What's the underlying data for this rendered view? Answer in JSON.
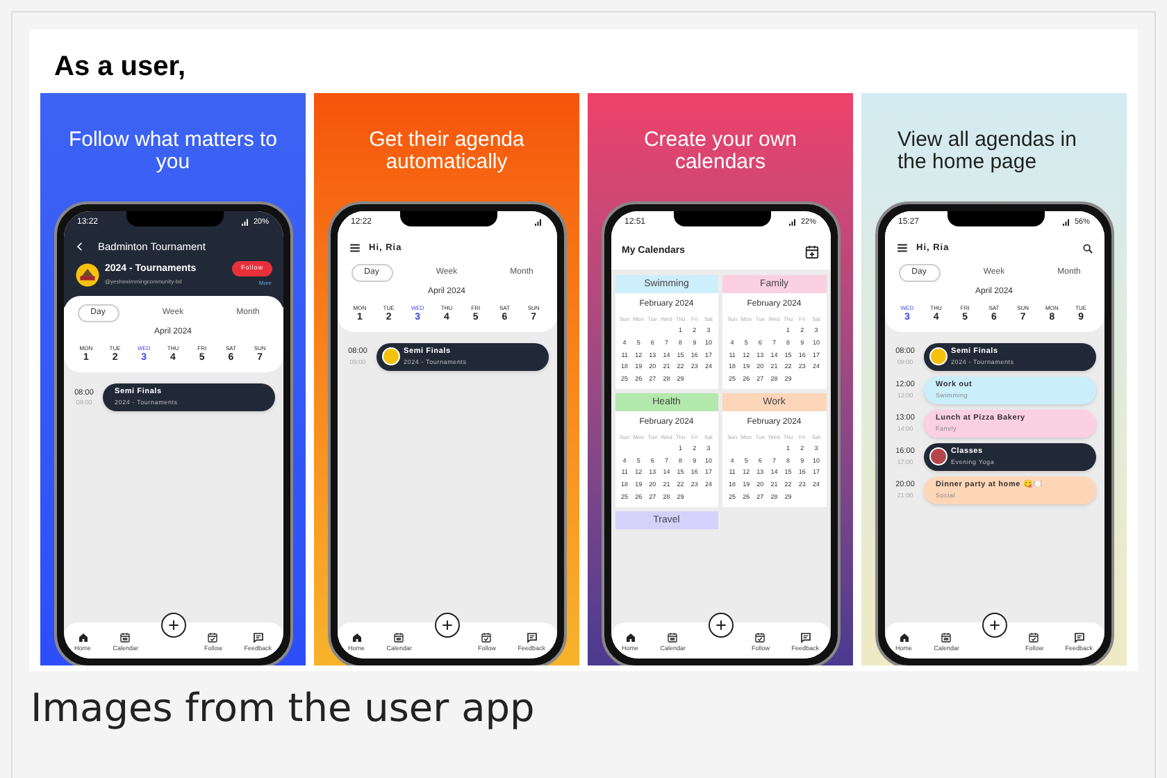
{
  "heading": "As a user,",
  "panels": [
    {
      "kind": "follow",
      "headline": "Follow what matters to you",
      "time": "13:22",
      "battery": "20%",
      "title": "Badminton Tournament",
      "org": "2024 - Tournaments",
      "handle": "@yeshswimmingcommunity-bd",
      "follow_button": "Follow",
      "more_link": "More",
      "view_tabs": [
        {
          "label": "Day",
          "selected": true
        },
        {
          "label": "Week",
          "selected": false
        },
        {
          "label": "Month",
          "selected": false
        }
      ],
      "month": "April 2024",
      "days": [
        {
          "dow": "MON",
          "date": "1",
          "selected": false
        },
        {
          "dow": "TUE",
          "date": "2",
          "selected": false
        },
        {
          "dow": "WED",
          "date": "3",
          "selected": true
        },
        {
          "dow": "THU",
          "date": "4",
          "selected": false
        },
        {
          "dow": "FRI",
          "date": "5",
          "selected": false
        },
        {
          "dow": "SAT",
          "date": "6",
          "selected": false
        },
        {
          "dow": "SUN",
          "date": "7",
          "selected": false
        }
      ],
      "events": [
        {
          "start": "08:00",
          "end": "09:00",
          "title": "Semi Finals",
          "subtitle": "2024 - Tournaments",
          "color": "#222936",
          "kind": "plain"
        }
      ],
      "nav": [
        {
          "label": "Home",
          "kind": "home"
        },
        {
          "label": "Calendar",
          "kind": "calendar"
        },
        {
          "label": "Follow",
          "kind": "follow"
        },
        {
          "label": "Feedback",
          "kind": "feedback"
        }
      ]
    },
    {
      "kind": "home",
      "headline": "Get their agenda automatically",
      "time": "12:22",
      "greeting": "Hi, Ria",
      "search_icon": false,
      "view_tabs": [
        {
          "label": "Day",
          "selected": true
        },
        {
          "label": "Week",
          "selected": false
        },
        {
          "label": "Month",
          "selected": false
        }
      ],
      "month": "April 2024",
      "days": [
        {
          "dow": "MON",
          "date": "1",
          "selected": false
        },
        {
          "dow": "TUE",
          "date": "2",
          "selected": false
        },
        {
          "dow": "WED",
          "date": "3",
          "selected": true
        },
        {
          "dow": "THU",
          "date": "4",
          "selected": false
        },
        {
          "dow": "FRI",
          "date": "5",
          "selected": false
        },
        {
          "dow": "SAT",
          "date": "6",
          "selected": false
        },
        {
          "dow": "SUN",
          "date": "7",
          "selected": false
        }
      ],
      "events": [
        {
          "start": "08:00",
          "end": "09:00",
          "title": "Semi Finals",
          "subtitle": "2024 - Tournaments",
          "color": "#222936",
          "kind": "team"
        }
      ],
      "nav": [
        {
          "label": "Home",
          "kind": "home"
        },
        {
          "label": "Calendar",
          "kind": "calendar"
        },
        {
          "label": "Follow",
          "kind": "follow"
        },
        {
          "label": "Feedback",
          "kind": "feedback"
        }
      ]
    },
    {
      "kind": "calendars",
      "headline": "Create your own calendars",
      "time": "12:51",
      "battery": "22%",
      "title": "My Calendars",
      "calendars": [
        {
          "name": "Swimming",
          "color": "#cdeefb",
          "month": "February 2024",
          "weekdays": [
            "Sun",
            "Mon",
            "Tue",
            "Wed",
            "Thu",
            "Fri",
            "Sat"
          ],
          "weeks": [
            [
              "1",
              "2",
              "3"
            ],
            [
              "4",
              "5",
              "6",
              "7",
              "8",
              "9",
              "10"
            ],
            [
              "11",
              "12",
              "13",
              "14",
              "15",
              "16",
              "17"
            ],
            [
              "18",
              "19",
              "20",
              "21",
              "22",
              "23",
              "24"
            ],
            [
              "25",
              "26",
              "27",
              "28",
              "29"
            ]
          ]
        },
        {
          "name": "Family",
          "color": "#fbd0e0",
          "month": "February 2024",
          "weekdays": [
            "Sun",
            "Mon",
            "Tue",
            "Wed",
            "Thu",
            "Fri",
            "Sat"
          ],
          "weeks": [
            [
              "1",
              "2",
              "3"
            ],
            [
              "4",
              "5",
              "6",
              "7",
              "8",
              "9",
              "10"
            ],
            [
              "11",
              "12",
              "13",
              "14",
              "15",
              "16",
              "17"
            ],
            [
              "18",
              "19",
              "20",
              "21",
              "22",
              "23",
              "24"
            ],
            [
              "25",
              "26",
              "27",
              "28",
              "29"
            ]
          ]
        },
        {
          "name": "Health",
          "color": "#b4e9ae",
          "month": "February 2024",
          "weekdays": [
            "Sun",
            "Mon",
            "Tue",
            "Wed",
            "Thu",
            "Fri",
            "Sat"
          ],
          "weeks": [
            [
              "1",
              "2",
              "3"
            ],
            [
              "4",
              "5",
              "6",
              "7",
              "8",
              "9",
              "10"
            ],
            [
              "11",
              "12",
              "13",
              "14",
              "15",
              "16",
              "17"
            ],
            [
              "18",
              "19",
              "20",
              "21",
              "22",
              "23",
              "24"
            ],
            [
              "25",
              "26",
              "27",
              "28",
              "29"
            ]
          ]
        },
        {
          "name": "Work",
          "color": "#fdd5b8",
          "month": "February 2024",
          "weekdays": [
            "Sun",
            "Mon",
            "Tue",
            "Wed",
            "Thu",
            "Fri",
            "Sat"
          ],
          "weeks": [
            [
              "1",
              "2",
              "3"
            ],
            [
              "4",
              "5",
              "6",
              "7",
              "8",
              "9",
              "10"
            ],
            [
              "11",
              "12",
              "13",
              "14",
              "15",
              "16",
              "17"
            ],
            [
              "18",
              "19",
              "20",
              "21",
              "22",
              "23",
              "24"
            ],
            [
              "25",
              "26",
              "27",
              "28",
              "29"
            ]
          ]
        },
        {
          "name": "Travel",
          "color": "#d4d1fb"
        }
      ],
      "nav": [
        {
          "label": "Home",
          "kind": "home"
        },
        {
          "label": "Calendar",
          "kind": "calendar"
        },
        {
          "label": "Follow",
          "kind": "follow"
        },
        {
          "label": "Feedback",
          "kind": "feedback"
        }
      ]
    },
    {
      "kind": "home",
      "headline": "View all agendas in the home page",
      "time": "15:27",
      "battery": "56%",
      "greeting": "Hi, Ria",
      "search_icon": true,
      "view_tabs": [
        {
          "label": "Day",
          "selected": true
        },
        {
          "label": "Week",
          "selected": false
        },
        {
          "label": "Month",
          "selected": false
        }
      ],
      "month": "April 2024",
      "days": [
        {
          "dow": "WED",
          "date": "3",
          "selected": true
        },
        {
          "dow": "THU",
          "date": "4",
          "selected": false
        },
        {
          "dow": "FRI",
          "date": "5",
          "selected": false
        },
        {
          "dow": "SAT",
          "date": "6",
          "selected": false
        },
        {
          "dow": "SUN",
          "date": "7",
          "selected": false
        },
        {
          "dow": "MON",
          "date": "8",
          "selected": false
        },
        {
          "dow": "TUE",
          "date": "9",
          "selected": false
        }
      ],
      "events": [
        {
          "start": "08:00",
          "end": "09:00",
          "title": "Semi Finals",
          "subtitle": "2024 - Tournaments",
          "color": "#222936",
          "kind": "team"
        },
        {
          "start": "12:00",
          "end": "13:00",
          "title": "Work out",
          "subtitle": "Swimming",
          "color": "#cbeefb",
          "kind": "plain"
        },
        {
          "start": "13:00",
          "end": "14:00",
          "title": "Lunch at Pizza Bakery",
          "subtitle": "Family",
          "color": "#fbd0e0",
          "kind": "plain"
        },
        {
          "start": "16:00",
          "end": "17:00",
          "title": "Classes",
          "subtitle": "Evening Yoga",
          "color": "#222936",
          "kind": "class"
        },
        {
          "start": "20:00",
          "end": "21:00",
          "title": "Dinner party at home 😋🍽️",
          "subtitle": "Social",
          "color": "#fdd6b8",
          "kind": "plain"
        }
      ],
      "nav": [
        {
          "label": "Home",
          "kind": "home"
        },
        {
          "label": "Calendar",
          "kind": "calendar"
        },
        {
          "label": "Follow",
          "kind": "follow"
        },
        {
          "label": "Feedback",
          "kind": "feedback"
        }
      ]
    }
  ],
  "caption": "Images from the user app"
}
